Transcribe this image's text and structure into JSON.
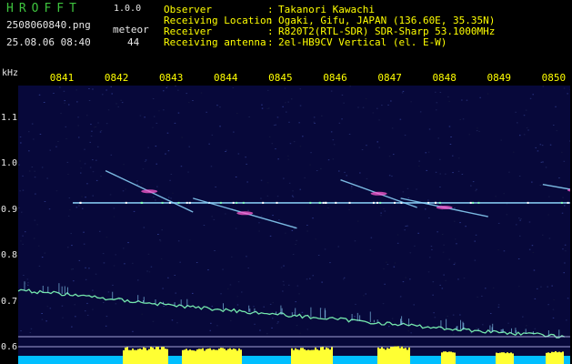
{
  "app": {
    "name": "HROFFT",
    "version": "1.0.0",
    "filename": "2508060840.png",
    "datetime": "25.08.06 08:40",
    "meteor_label": "meteor",
    "meteor_count": "44"
  },
  "info": [
    {
      "label": "Observer",
      "value": "Takanori Kawachi"
    },
    {
      "label": "Receiving Location",
      "value": "Ogaki, Gifu, JAPAN (136.60E, 35.35N)"
    },
    {
      "label": "Receiver",
      "value": "R820T2(RTL-SDR) SDR-Sharp 53.1000MHz"
    },
    {
      "label": "Receiving antenna",
      "value": "2el-HB9CV Vertical (el. E-W)"
    }
  ],
  "colors": {
    "background": "#000000",
    "plot_background": "#07083a",
    "label_yellow": "#ffff00",
    "title_green": "#3ec43e",
    "text_white": "#e8e8e8",
    "carrier": "#8fd8ff",
    "meteor_echo": "#ff5cd0",
    "noise_floor": "#7fffb8",
    "signal_strength": "#ffff33",
    "baseline": "#00bfff"
  },
  "chart_data": {
    "type": "heatmap",
    "xlabel": "",
    "ylabel": "kHz",
    "time_ticks": [
      "0841",
      "0842",
      "0843",
      "0844",
      "0845",
      "0846",
      "0847",
      "0848",
      "0849",
      "0850"
    ],
    "freq_ticks": [
      "1.1",
      "1.0",
      "0.9",
      "0.8",
      "0.7",
      "0.6"
    ],
    "ylim": [
      0.6,
      1.15
    ],
    "carrier_khz": 0.915,
    "meteor_echoes": [
      {
        "t_start": 0.8,
        "t_end": 2.4,
        "f_start": 0.985,
        "f_end": 0.895
      },
      {
        "t_start": 2.4,
        "t_end": 4.3,
        "f_start": 0.925,
        "f_end": 0.86
      },
      {
        "t_start": 5.1,
        "t_end": 6.5,
        "f_start": 0.965,
        "f_end": 0.905
      },
      {
        "t_start": 6.2,
        "t_end": 7.8,
        "f_start": 0.925,
        "f_end": 0.885
      },
      {
        "t_start": 8.8,
        "t_end": 10.0,
        "f_start": 0.955,
        "f_end": 0.93
      }
    ],
    "noise_floor": {
      "t": [
        0,
        1,
        2,
        3,
        4,
        5,
        6,
        7,
        8,
        9,
        10
      ],
      "f": [
        0.725,
        0.715,
        0.702,
        0.69,
        0.68,
        0.67,
        0.66,
        0.65,
        0.64,
        0.632,
        0.624
      ]
    },
    "grid": false
  }
}
